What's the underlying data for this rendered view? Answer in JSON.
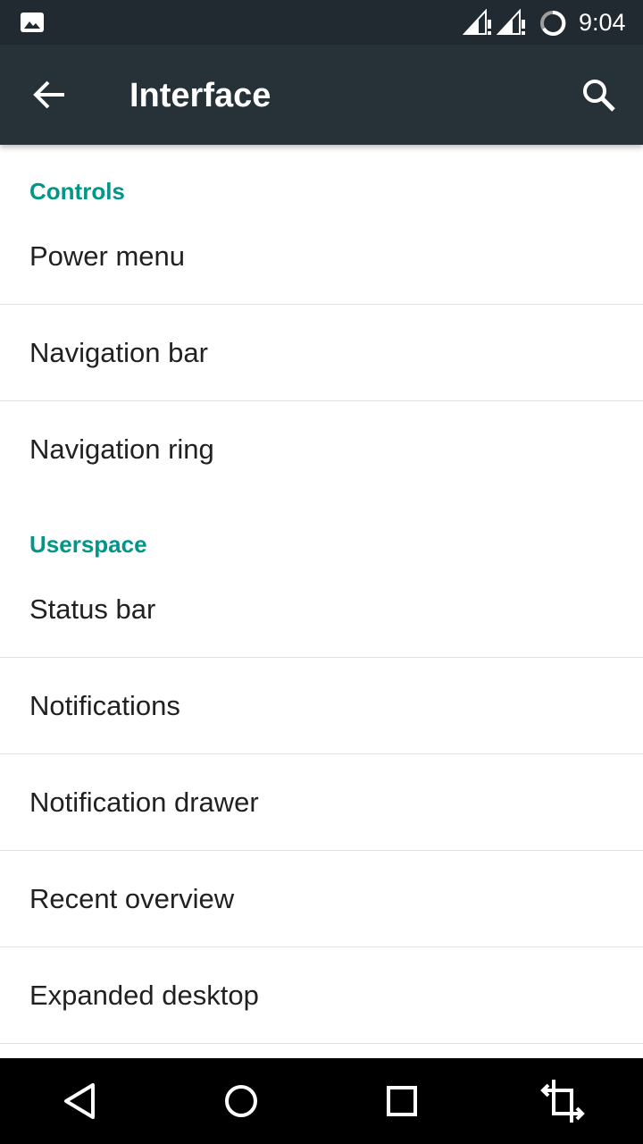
{
  "status_bar": {
    "time": "9:04",
    "icons": [
      "gallery-icon",
      "signal-alert-icon",
      "signal-alert-icon",
      "sync-icon"
    ]
  },
  "app_bar": {
    "title": "Interface",
    "back_icon": "arrow-back-icon",
    "search_icon": "search-icon"
  },
  "sections": [
    {
      "header": "Controls",
      "items": [
        "Power menu",
        "Navigation bar",
        "Navigation ring"
      ]
    },
    {
      "header": "Userspace",
      "items": [
        "Status bar",
        "Notifications",
        "Notification drawer",
        "Recent overview",
        "Expanded desktop"
      ]
    }
  ],
  "nav_bar": {
    "icons": [
      "back-triangle-icon",
      "home-circle-icon",
      "recents-square-icon",
      "rotate-icon"
    ]
  },
  "colors": {
    "status_bar": "#212a30",
    "app_bar": "#263238",
    "accent": "#009688",
    "text": "#212121",
    "divider": "#e0e0e0"
  }
}
